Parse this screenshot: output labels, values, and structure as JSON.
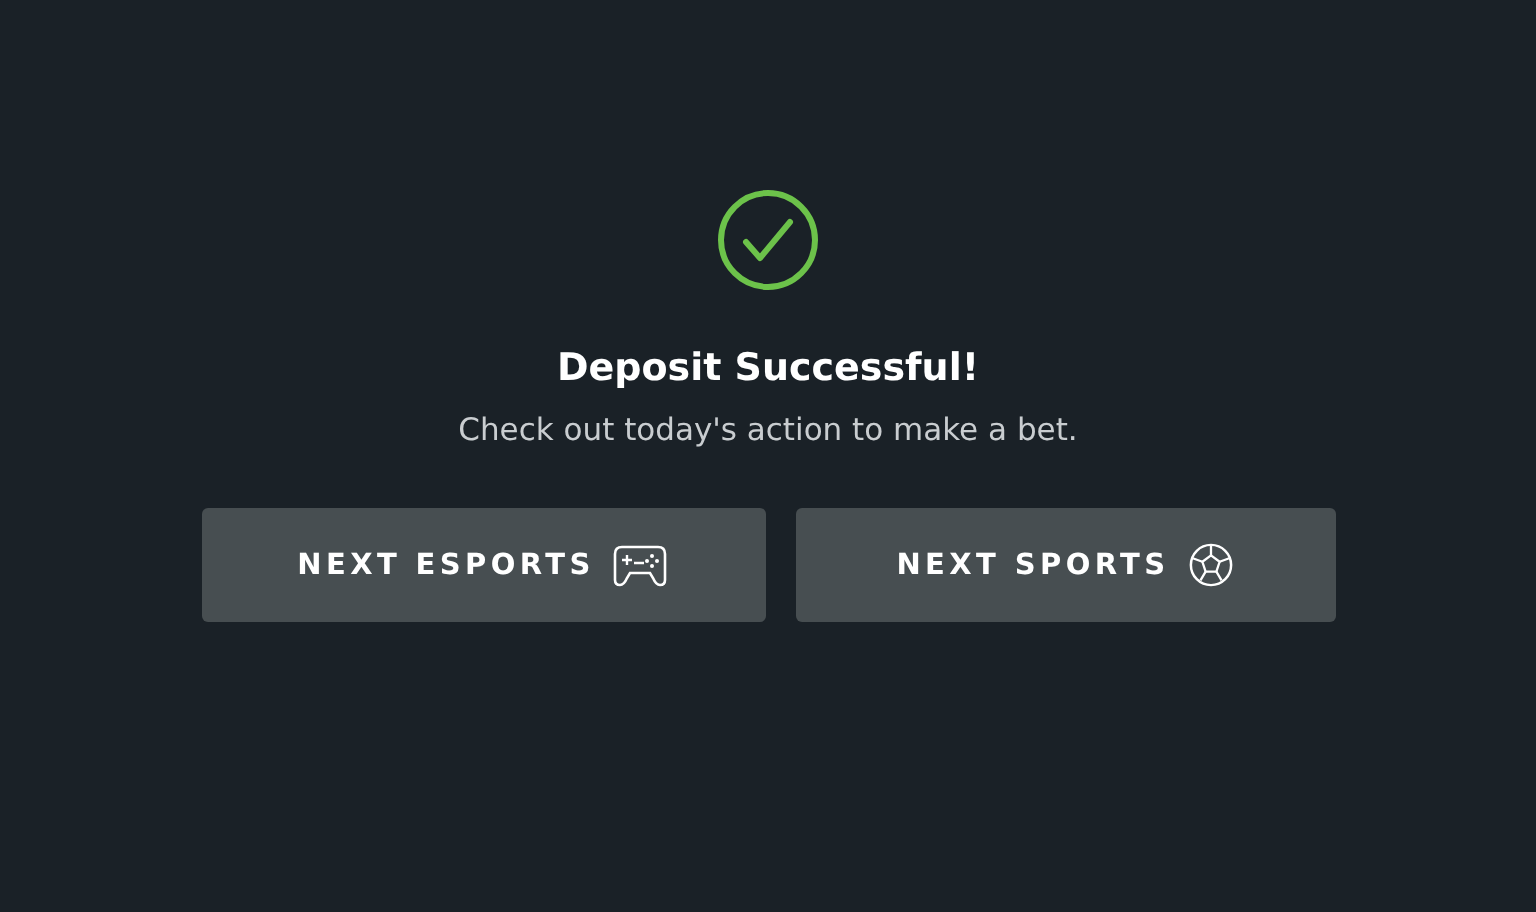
{
  "status": {
    "kind": "success"
  },
  "title": "Deposit Successful!",
  "message": "Check out today's action to make a bet.",
  "buttons": [
    {
      "label": "NEXT ESPORTS",
      "kind": "esports"
    },
    {
      "label": "NEXT SPORTS",
      "kind": "sports"
    }
  ]
}
